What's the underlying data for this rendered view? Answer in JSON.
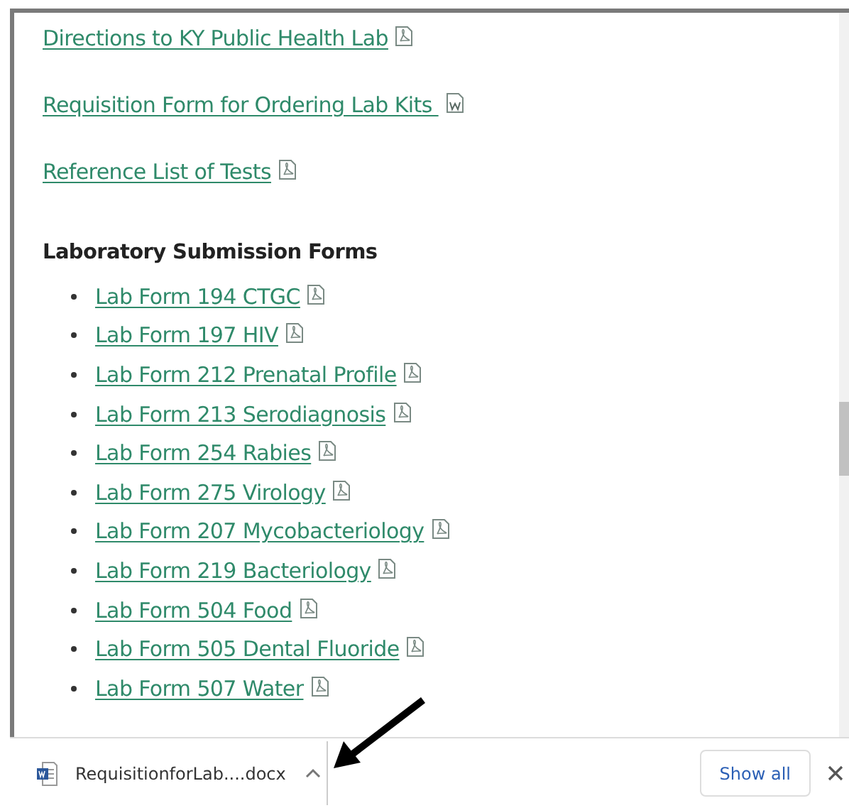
{
  "links": [
    {
      "label": "Directions to KY Public Health Lab",
      "kind": "pdf"
    },
    {
      "label": "Requisition Form for Ordering Lab Kits ",
      "kind": "word"
    },
    {
      "label": "Reference List of Tests",
      "kind": "pdf"
    }
  ],
  "section": {
    "heading": "Laboratory Submission Forms",
    "items": [
      {
        "label": "Lab Form 194 CTGC",
        "kind": "pdf"
      },
      {
        "label": "Lab Form 197 HIV",
        "kind": "pdf"
      },
      {
        "label": "Lab Form 212 Prenatal Profile",
        "kind": "pdf"
      },
      {
        "label": "Lab Form 213 Serodiagnosis",
        "kind": "pdf"
      },
      {
        "label": "Lab Form 254 Rabies",
        "kind": "pdf"
      },
      {
        "label": "Lab Form 275 Virology",
        "kind": "pdf"
      },
      {
        "label": "Lab Form 207 Mycobacteriology",
        "kind": "pdf"
      },
      {
        "label": "Lab Form 219 Bacteriology",
        "kind": "pdf"
      },
      {
        "label": "Lab Form 504 Food",
        "kind": "pdf"
      },
      {
        "label": "Lab Form 505 Dental Fluoride",
        "kind": "pdf"
      },
      {
        "label": "Lab Form 507 Water",
        "kind": "pdf"
      }
    ]
  },
  "download_bar": {
    "file": "RequisitionforLab....docx",
    "button": "Show all"
  }
}
